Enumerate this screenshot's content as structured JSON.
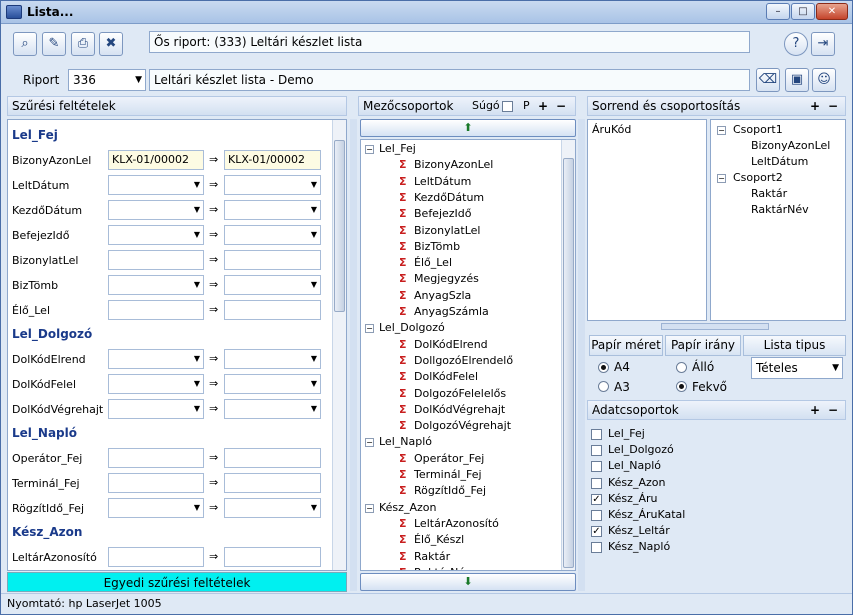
{
  "window": {
    "title": "Lista..."
  },
  "toolbar": {
    "report_info": "Ős riport: (333)  Leltári készlet lista"
  },
  "riport": {
    "label": "Riport",
    "number": "336",
    "name": "Leltári készlet lista - Demo"
  },
  "filters": {
    "header": "Szűrési feltételek",
    "groups": [
      {
        "name": "Lel_Fej",
        "fields": [
          {
            "label": "BizonyAzonLel",
            "from": "KLX-01/00002",
            "to": "KLX-01/00002",
            "type": "text"
          },
          {
            "label": "LeltDátum",
            "from": "",
            "to": "",
            "type": "combo"
          },
          {
            "label": "KezdőDátum",
            "from": "",
            "to": "",
            "type": "combo"
          },
          {
            "label": "BefejezIdő",
            "from": "",
            "to": "",
            "type": "combo"
          },
          {
            "label": "BizonylatLel",
            "from": "",
            "to": "",
            "type": "text"
          },
          {
            "label": "BizTömb",
            "from": "",
            "to": "",
            "type": "combo"
          },
          {
            "label": "Élő_Lel",
            "from": "",
            "to": "",
            "type": "text"
          }
        ]
      },
      {
        "name": "Lel_Dolgozó",
        "fields": [
          {
            "label": "DolKódElrend",
            "from": "",
            "to": "",
            "type": "combo"
          },
          {
            "label": "DolKódFelel",
            "from": "",
            "to": "",
            "type": "combo"
          },
          {
            "label": "DolKódVégrehajt",
            "from": "",
            "to": "",
            "type": "combo"
          }
        ]
      },
      {
        "name": "Lel_Napló",
        "fields": [
          {
            "label": "Operátor_Fej",
            "from": "",
            "to": "",
            "type": "text"
          },
          {
            "label": "Terminál_Fej",
            "from": "",
            "to": "",
            "type": "text"
          },
          {
            "label": "RögzítIdő_Fej",
            "from": "",
            "to": "",
            "type": "combo"
          }
        ]
      },
      {
        "name": "Kész_Azon",
        "fields": [
          {
            "label": "LeltárAzonosító",
            "from": "",
            "to": "",
            "type": "text"
          }
        ]
      }
    ],
    "footer": "Egyedi szűrési feltételek"
  },
  "fieldgroups": {
    "header": "Mezőcsoportok",
    "help_label": "Súgó",
    "p_label": "P",
    "tree": [
      {
        "name": "Lel_Fej",
        "children": [
          "BizonyAzonLel",
          "LeltDátum",
          "KezdőDátum",
          "BefejezIdő",
          "BizonylatLel",
          "BizTömb",
          "Élő_Lel",
          "Megjegyzés",
          "AnyagSzla",
          "AnyagSzámla"
        ]
      },
      {
        "name": "Lel_Dolgozó",
        "children": [
          "DolKódElrend",
          "DollgozóElrendelő",
          "DolKódFelel",
          "DolgozóFelelelős",
          "DolKódVégrehajt",
          "DolgozóVégrehajt"
        ]
      },
      {
        "name": "Lel_Napló",
        "children": [
          "Operátor_Fej",
          "Terminál_Fej",
          "RögzítIdő_Fej"
        ]
      },
      {
        "name": "Kész_Azon",
        "children": [
          "LeltárAzonosító",
          "Élő_Készl",
          "Raktár",
          "RaktárNév"
        ]
      }
    ]
  },
  "sorting": {
    "header": "Sorrend és csoportosítás",
    "order_items": [
      "ÁruKód"
    ],
    "groups": [
      {
        "name": "Csoport1",
        "children": [
          "BizonyAzonLel",
          "LeltDátum"
        ]
      },
      {
        "name": "Csoport2",
        "children": [
          "Raktár",
          "RaktárNév"
        ]
      }
    ]
  },
  "paper": {
    "size_label": "Papír méret",
    "orient_label": "Papír irány",
    "list_type_label": "Lista tipus",
    "sizes": [
      "A4",
      "A3"
    ],
    "selected_size": "A4",
    "orients": [
      "Álló",
      "Fekvő"
    ],
    "selected_orient": "Fekvő",
    "list_type": "Tételes"
  },
  "datagroups": {
    "header": "Adatcsoportok",
    "items": [
      {
        "label": "Lel_Fej",
        "checked": false
      },
      {
        "label": "Lel_Dolgozó",
        "checked": false
      },
      {
        "label": "Lel_Napló",
        "checked": false
      },
      {
        "label": "Kész_Azon",
        "checked": false
      },
      {
        "label": "Kész_Áru",
        "checked": true
      },
      {
        "label": "Kész_ÁruKatal",
        "checked": false
      },
      {
        "label": "Kész_Leltár",
        "checked": true
      },
      {
        "label": "Kész_Napló",
        "checked": false
      }
    ]
  },
  "status": {
    "printer": "Nyomtató: hp LaserJet 1005"
  }
}
